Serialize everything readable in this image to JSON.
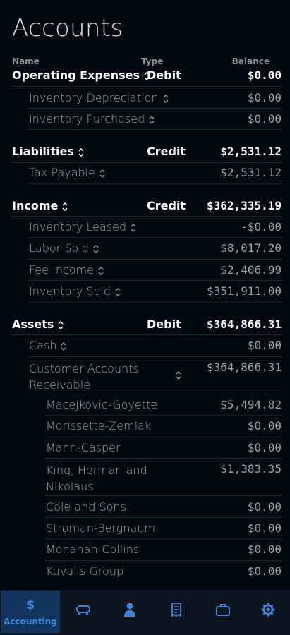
{
  "page": {
    "title": "Accounts"
  },
  "columns": {
    "name": "Name",
    "type": "Type",
    "balance": "Balance"
  },
  "groups": [
    {
      "name": "Operating Expenses",
      "type": "Debit",
      "balance": "$0.00",
      "children": [
        {
          "name": "Inventory Depreciation",
          "balance": "$0.00"
        },
        {
          "name": "Inventory Purchased",
          "balance": "$0.00"
        }
      ]
    },
    {
      "name": "Liabilities",
      "type": "Credit",
      "balance": "$2,531.12",
      "children": [
        {
          "name": "Tax Payable",
          "balance": "$2,531.12"
        }
      ]
    },
    {
      "name": "Income",
      "type": "Credit",
      "balance": "$362,335.19",
      "children": [
        {
          "name": "Inventory Leased",
          "balance": "-$0.00"
        },
        {
          "name": "Labor Sold",
          "balance": "$8,017.20"
        },
        {
          "name": "Fee Income",
          "balance": "$2,406.99"
        },
        {
          "name": "Inventory Sold",
          "balance": "$351,911.00"
        }
      ]
    },
    {
      "name": "Assets",
      "type": "Debit",
      "balance": "$364,866.31",
      "children": [
        {
          "name": "Cash",
          "balance": "$0.00"
        },
        {
          "name": "Customer Accounts Receivable",
          "balance": "$364,866.31",
          "children": [
            {
              "name": "Macejkovic-Goyette",
              "balance": "$5,494.82"
            },
            {
              "name": "Morissette-Zemlak",
              "balance": "$0.00"
            },
            {
              "name": "Mann-Casper",
              "balance": "$0.00"
            },
            {
              "name": "King, Herman and Nikolaus",
              "balance": "$1,383.35"
            },
            {
              "name": "Cole and Sons",
              "balance": "$0.00"
            },
            {
              "name": "Stroman-Bergnaum",
              "balance": "$0.00"
            },
            {
              "name": "Monahan-Collins",
              "balance": "$0.00"
            },
            {
              "name": "Kuvalis Group",
              "balance": "$0.00"
            }
          ]
        }
      ]
    }
  ],
  "nav": [
    {
      "icon": "dollar-icon",
      "label": "Accounting",
      "active": true
    },
    {
      "icon": "car-icon",
      "label": "",
      "active": false
    },
    {
      "icon": "person-icon",
      "label": "",
      "active": false
    },
    {
      "icon": "receipt-icon",
      "label": "",
      "active": false
    },
    {
      "icon": "briefcase-icon",
      "label": "",
      "active": false
    },
    {
      "icon": "gear-icon",
      "label": "",
      "active": false
    }
  ],
  "colors": {
    "accent": "#3d85d8",
    "background": "#030912",
    "navbar": "#0d1521",
    "active": "#12345d"
  }
}
